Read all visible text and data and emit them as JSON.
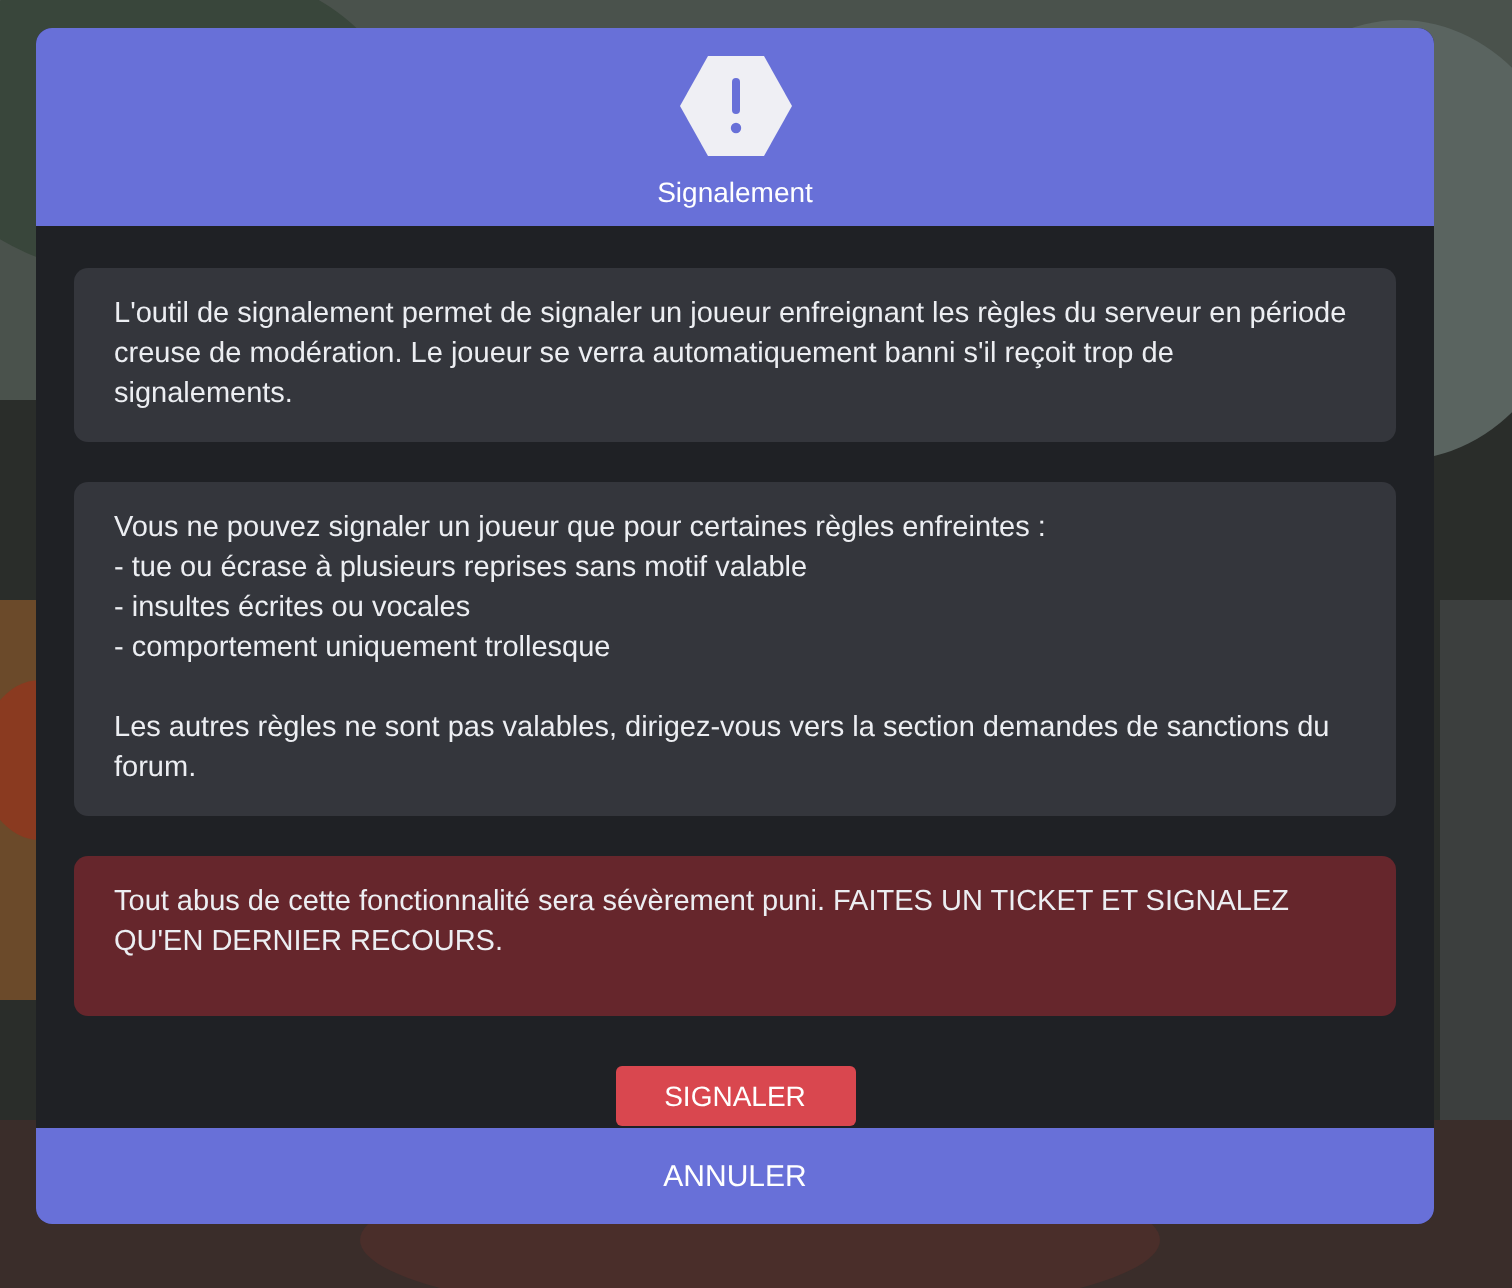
{
  "dialog": {
    "title": "Signalement",
    "panels": [
      {
        "kind": "info",
        "paragraphs": [
          "L'outil de signalement permet de signaler un joueur enfreignant les règles du serveur en période creuse de modération. Le joueur se verra automatiquement banni s'il reçoit trop de signalements."
        ]
      },
      {
        "kind": "info",
        "paragraphs": [
          "Vous ne pouvez signaler un joueur que pour certaines règles enfreintes :",
          "- tue ou écrase à plusieurs reprises sans motif valable",
          "- insultes écrites ou vocales",
          "- comportement uniquement trollesque",
          "Les autres règles ne sont pas valables, dirigez-vous vers la section demandes de sanctions du forum."
        ]
      },
      {
        "kind": "warning",
        "paragraphs": [
          "Tout abus de cette fonctionnalité sera sévèrement puni. FAITES UN TICKET ET SIGNALEZ QU'EN DERNIER RECOURS."
        ]
      }
    ],
    "report_button": "SIGNALER",
    "cancel_button": "ANNULER"
  }
}
